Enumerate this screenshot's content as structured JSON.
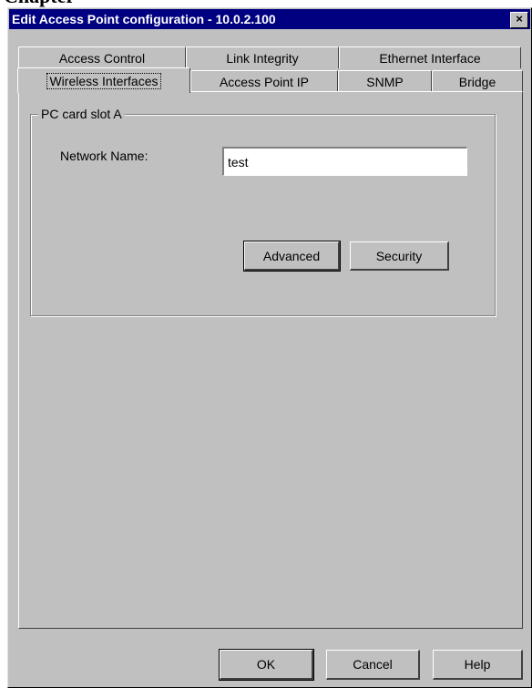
{
  "doc_heading_fragment": "Chapter",
  "window": {
    "title": "Edit Access Point configuration - 10.0.2.100",
    "close_symbol": "×"
  },
  "tabs": {
    "back_row": [
      "Access Control",
      "Link Integrity",
      "Ethernet Interface"
    ],
    "front_row": [
      "Wireless Interfaces",
      "Access Point IP",
      "SNMP",
      "Bridge"
    ],
    "selected": "Wireless Interfaces"
  },
  "group": {
    "title": "PC card slot A",
    "network_name_label": "Network Name:",
    "network_name_value": "test",
    "advanced_label": "Advanced",
    "security_label": "Security"
  },
  "footer": {
    "ok_label": "OK",
    "cancel_label": "Cancel",
    "help_label": "Help"
  }
}
